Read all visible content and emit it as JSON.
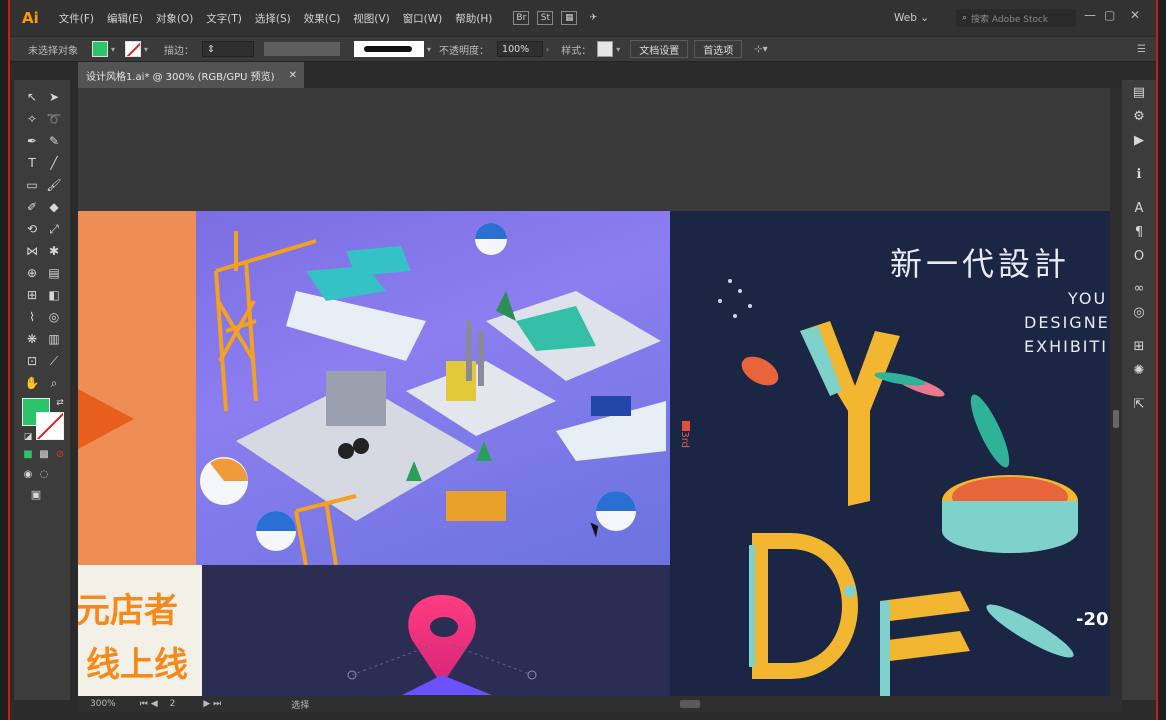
{
  "app": {
    "logo": "Ai"
  },
  "menu": [
    "文件(F)",
    "编辑(E)",
    "对象(O)",
    "文字(T)",
    "选择(S)",
    "效果(C)",
    "视图(V)",
    "窗口(W)",
    "帮助(H)"
  ],
  "menubar_icons": {
    "bridge": "Br",
    "stock": "St"
  },
  "workspace": "Web",
  "search": {
    "placeholder": "搜索 Adobe Stock"
  },
  "window_controls": {
    "minimize": "—",
    "restore": "▢",
    "close": "✕"
  },
  "control_bar": {
    "selection": "未选择对象",
    "stroke_label": "描边：",
    "opacity_label": "不透明度：",
    "opacity_value": "100%",
    "style_label": "样式：",
    "doc_setup": "文档设置",
    "preferences": "首选项"
  },
  "document_tab": {
    "title": "设计风格1.ai* @ 300% (RGB/GPU 预览)",
    "close": "✕"
  },
  "artboard": {
    "cn_title": "新一代設計",
    "en_lines": [
      "YOU",
      "DESIGNE",
      "EXHIBITI"
    ],
    "year": "-20",
    "side_code": "33rd",
    "promo_lines": [
      "元店者",
      "线上线"
    ]
  },
  "status_bar": {
    "zoom": "300%",
    "page": "2",
    "mode": "选择"
  },
  "colors": {
    "fill": "#2bc46a",
    "accent": "#ff9a00",
    "frame": "#bb2222"
  }
}
